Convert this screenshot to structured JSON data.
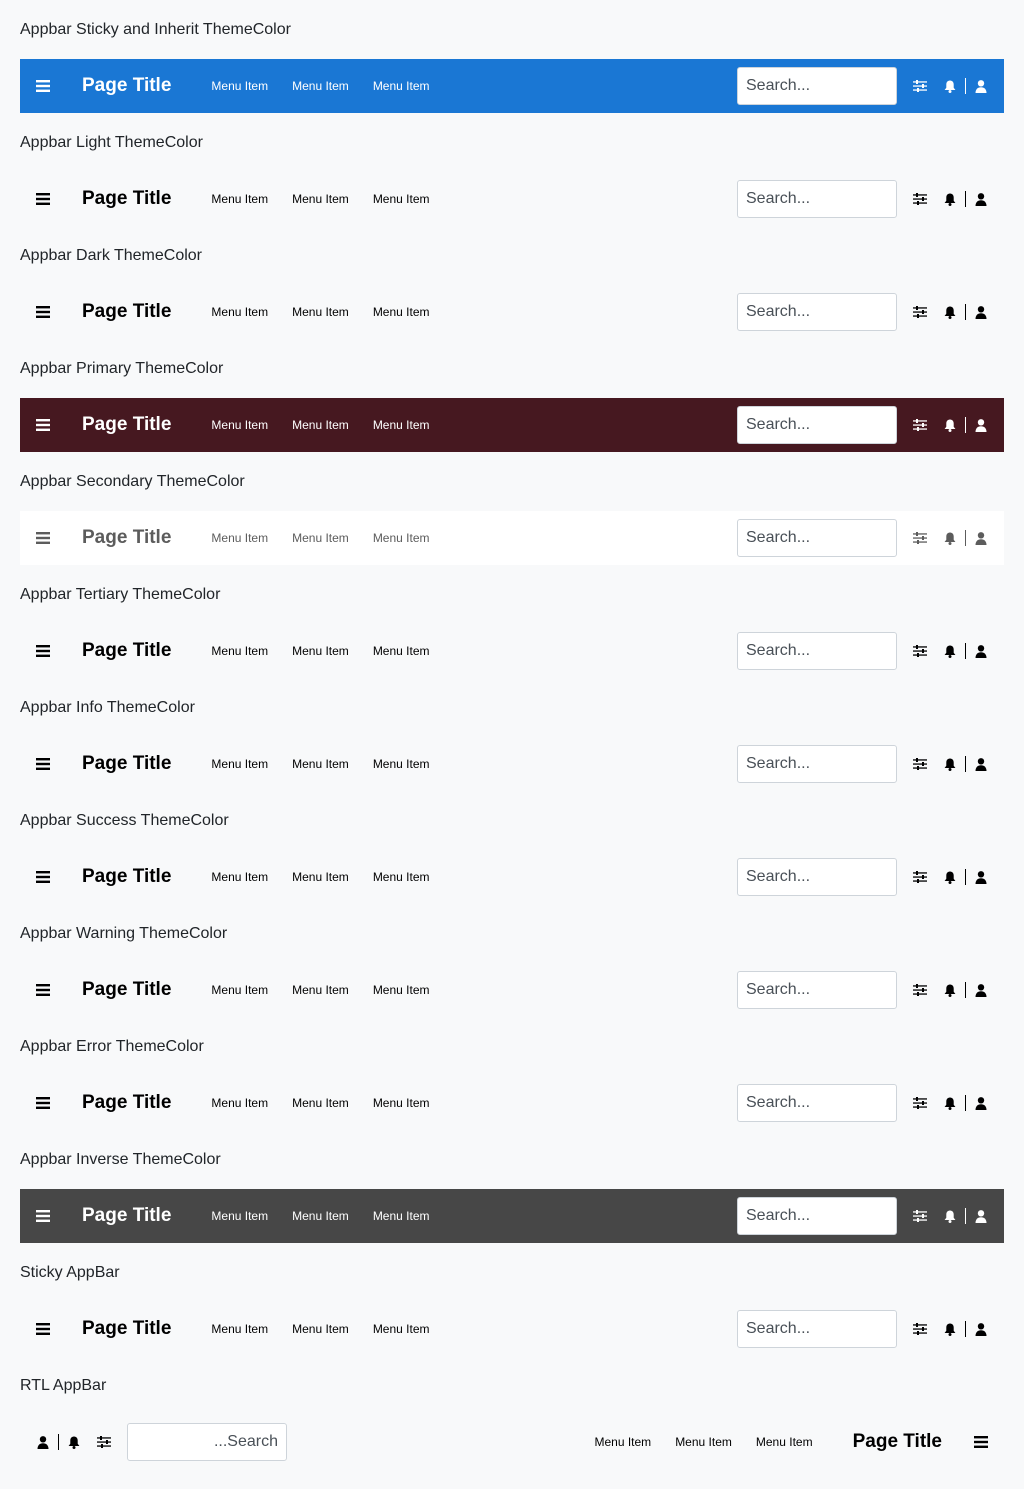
{
  "appbars": [
    {
      "key": "inherit",
      "heading": "Appbar Sticky and Inherit ThemeColor"
    },
    {
      "key": "light",
      "heading": "Appbar Light ThemeColor"
    },
    {
      "key": "dark",
      "heading": "Appbar Dark ThemeColor"
    },
    {
      "key": "primary",
      "heading": "Appbar Primary ThemeColor"
    },
    {
      "key": "secondary",
      "heading": "Appbar Secondary ThemeColor"
    },
    {
      "key": "tertiary",
      "heading": "Appbar Tertiary ThemeColor"
    },
    {
      "key": "info",
      "heading": "Appbar Info ThemeColor"
    },
    {
      "key": "success",
      "heading": "Appbar Success ThemeColor"
    },
    {
      "key": "warning",
      "heading": "Appbar Warning ThemeColor"
    },
    {
      "key": "error",
      "heading": "Appbar Error ThemeColor"
    },
    {
      "key": "inverse",
      "heading": "Appbar Inverse ThemeColor"
    },
    {
      "key": "sticky",
      "heading": "Sticky AppBar"
    },
    {
      "key": "rtl",
      "heading": "RTL AppBar",
      "rtl": true
    }
  ],
  "bar": {
    "title": "Page Title",
    "menu_items": [
      "Menu Item",
      "Menu Item",
      "Menu Item"
    ],
    "search_placeholder": "Search...",
    "icons": {
      "menu": "hamburger-menu-icon",
      "filter": "sliders-icon",
      "notifications": "bell-icon",
      "account": "user-icon"
    }
  },
  "colors": {
    "inherit": "#1a77d4",
    "primary": "#461820",
    "secondary": "#ffffff",
    "inverse": "#474747",
    "page_background": "#f8f9fa"
  }
}
